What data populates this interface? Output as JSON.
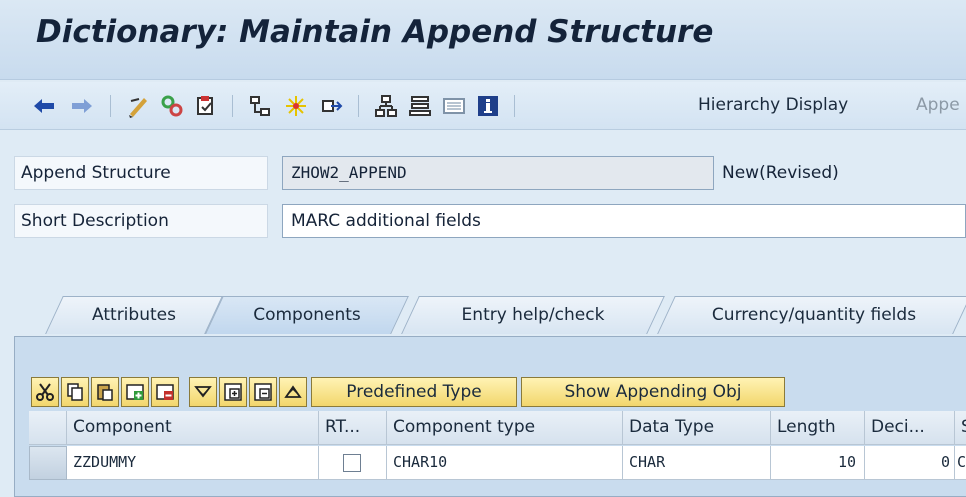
{
  "title": "Dictionary: Maintain Append Structure",
  "toolbar": {
    "hierarchy_display": "Hierarchy Display",
    "append_truncated": "Appe"
  },
  "form": {
    "append_structure_label": "Append Structure",
    "append_structure_value": "ZHOW2_APPEND",
    "status": "New(Revised)",
    "short_description_label": "Short Description",
    "short_description_value": "MARC additional fields"
  },
  "tabs": [
    "Attributes",
    "Components",
    "Entry help/check",
    "Currency/quantity fields"
  ],
  "active_tab": "Components",
  "table_toolbar": {
    "predefined_type": "Predefined Type",
    "show_appending_obj": "Show Appending Obj"
  },
  "table": {
    "columns": [
      "Component",
      "RT...",
      "Component type",
      "Data Type",
      "Length",
      "Deci...",
      "Sh"
    ],
    "rows": [
      {
        "component": "ZZDUMMY",
        "component_type": "CHAR10",
        "data_type": "CHAR",
        "length": "10",
        "decimals": "0",
        "short_text": "Ch"
      }
    ]
  },
  "colors": {
    "title_bg": "#c8dbee",
    "panel_bg": "#c9dcee",
    "button_bg": "#f2d66c"
  }
}
